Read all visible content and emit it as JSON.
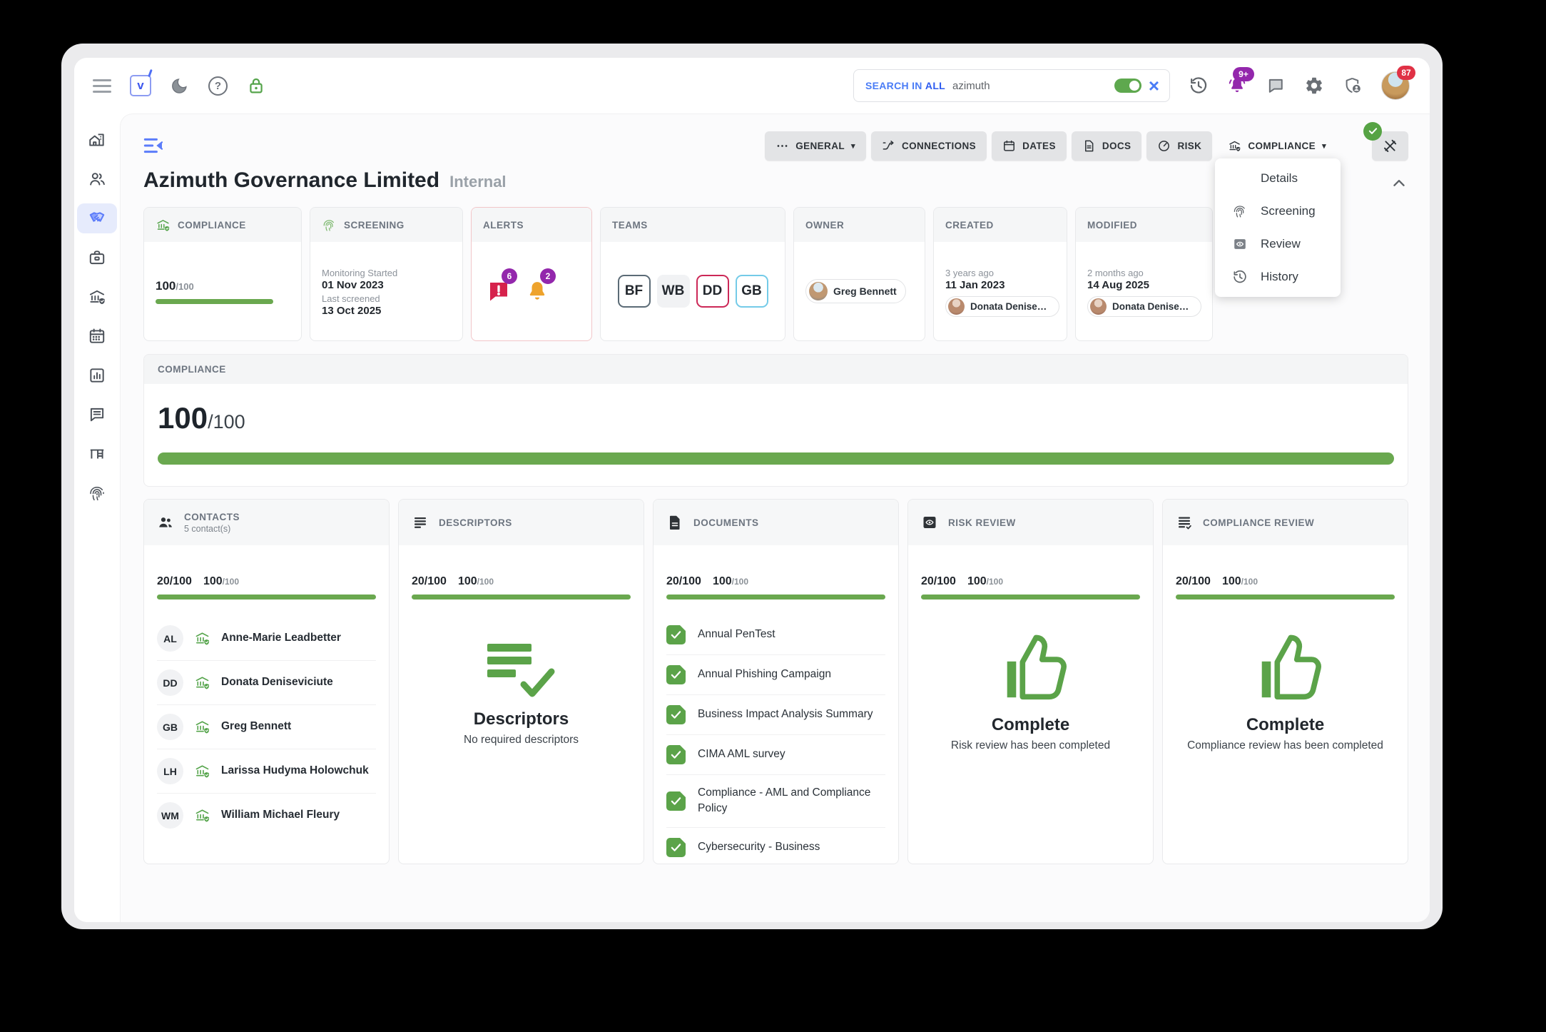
{
  "topbar": {
    "search": {
      "label_prefix": "SEARCH IN",
      "label_scope": "ALL",
      "query": "azimuth"
    },
    "notif_badge": "9+",
    "avatar_badge": "87"
  },
  "tabs": {
    "general": "GENERAL",
    "connections": "CONNECTIONS",
    "dates": "DATES",
    "docs": "DOCS",
    "risk": "RISK",
    "compliance": "COMPLIANCE"
  },
  "page": {
    "title": "Azimuth Governance Limited",
    "badge": "Internal"
  },
  "cards": {
    "compliance": {
      "title": "COMPLIANCE",
      "score": "100",
      "score_max": "/100"
    },
    "screening": {
      "title": "SCREENING",
      "l1": "Monitoring Started",
      "d1": "01 Nov 2023",
      "l2": "Last screened",
      "d2": "13 Oct 2025"
    },
    "alerts": {
      "title": "ALERTS",
      "msg_count": "6",
      "bell_count": "2"
    },
    "teams": {
      "title": "TEAMS",
      "chips": [
        {
          "label": "BF"
        },
        {
          "label": "WB"
        },
        {
          "label": "DD"
        },
        {
          "label": "GB"
        }
      ]
    },
    "owner": {
      "title": "OWNER",
      "name": "Greg Bennett"
    },
    "created": {
      "title": "CREATED",
      "ago": "3 years ago",
      "date": "11 Jan 2023",
      "by": "Donata Denisev…"
    },
    "modified": {
      "title": "MODIFIED",
      "ago": "2 months ago",
      "date": "14 Aug 2025",
      "by": "Donata Denisev…"
    }
  },
  "menu": {
    "items": [
      {
        "label": "Details"
      },
      {
        "label": "Screening"
      },
      {
        "label": "Review"
      },
      {
        "label": "History"
      }
    ]
  },
  "section": {
    "title": "COMPLIANCE",
    "score": "100",
    "score_max": "/100"
  },
  "panels": {
    "contacts": {
      "title": "CONTACTS",
      "subtitle": "5 contact(s)",
      "p1": "20/100",
      "p2": "100",
      "p2max": "/100",
      "items": [
        {
          "initials": "AL",
          "name": "Anne-Marie Leadbetter"
        },
        {
          "initials": "DD",
          "name": "Donata Deniseviciute"
        },
        {
          "initials": "GB",
          "name": "Greg Bennett"
        },
        {
          "initials": "LH",
          "name": "Larissa Hudyma Holowchuk"
        },
        {
          "initials": "WM",
          "name": "William Michael Fleury"
        }
      ]
    },
    "descriptors": {
      "title": "DESCRIPTORS",
      "p1": "20/100",
      "p2": "100",
      "p2max": "/100",
      "heading": "Descriptors",
      "note": "No required descriptors"
    },
    "documents": {
      "title": "DOCUMENTS",
      "p1": "20/100",
      "p2": "100",
      "p2max": "/100",
      "items": [
        {
          "name": "Annual PenTest"
        },
        {
          "name": "Annual Phishing Campaign"
        },
        {
          "name": "Business Impact Analysis Summary"
        },
        {
          "name": "CIMA AML survey"
        },
        {
          "name": "Compliance - AML and Compliance Policy"
        },
        {
          "name": "Cybersecurity - Business"
        }
      ]
    },
    "risk_review": {
      "title": "RISK REVIEW",
      "p1": "20/100",
      "p2": "100",
      "p2max": "/100",
      "status": "Complete",
      "note": "Risk review has been completed"
    },
    "compliance_review": {
      "title": "COMPLIANCE REVIEW",
      "p1": "20/100",
      "p2": "100",
      "p2max": "/100",
      "status": "Complete",
      "note": "Compliance review has been completed"
    }
  },
  "colors": {
    "green": "#6aa84f",
    "purple_badge": "#9327ac",
    "red_badge": "#e03145",
    "alert_red": "#d6224c",
    "alert_amber": "#eea32c",
    "accent_blue": "#4d6ef5",
    "chip_bf_border": "#5b6b76",
    "chip_dd_border": "#cc2857",
    "chip_gb_border": "#74cbe8"
  },
  "icons": {
    "sidebar": [
      "building-home",
      "users",
      "handshake",
      "briefcase",
      "bank-shield",
      "calendar",
      "bar-chart",
      "chat",
      "desk",
      "fingerprint"
    ]
  }
}
